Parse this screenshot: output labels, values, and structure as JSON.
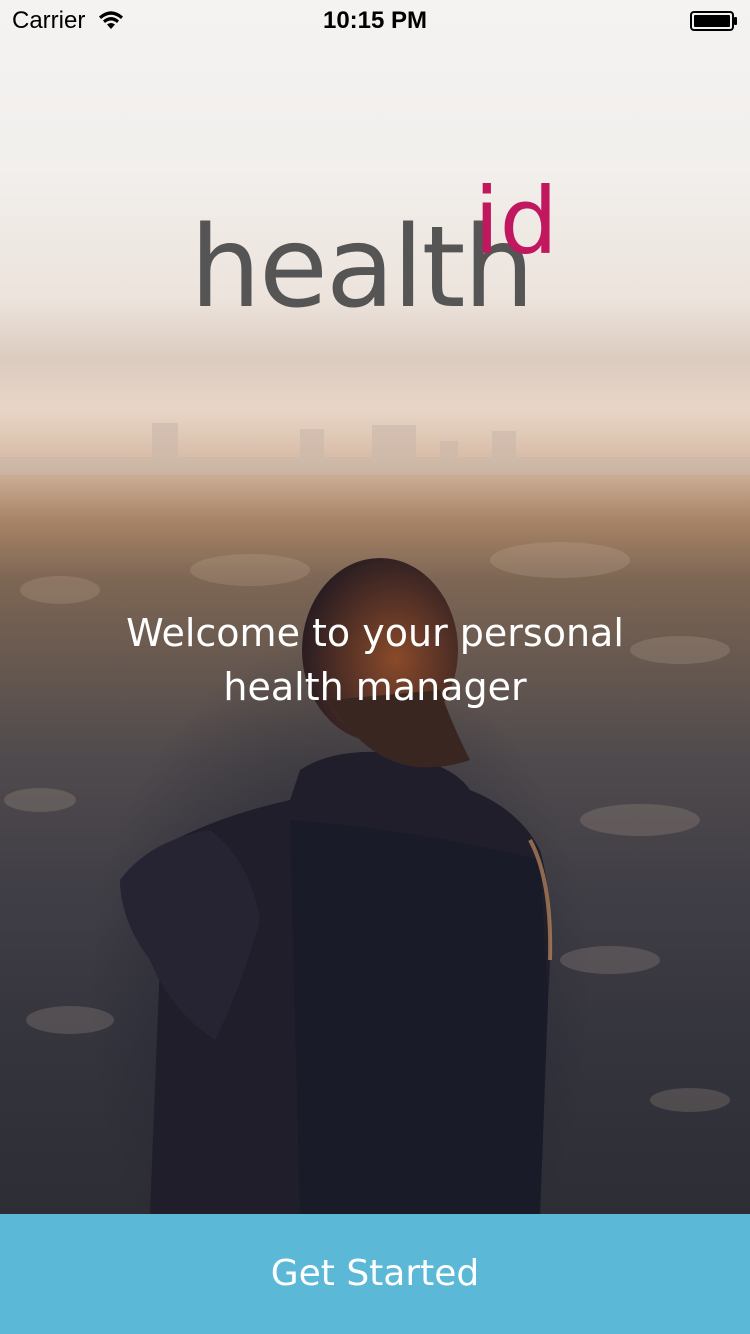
{
  "status_bar": {
    "carrier": "Carrier",
    "time": "10:15 PM",
    "wifi_icon": "wifi-icon",
    "battery_icon": "battery-icon"
  },
  "logo": {
    "word": "health",
    "superscript": "id",
    "word_color": "#555555",
    "superscript_color": "#c1175f"
  },
  "welcome": {
    "message": "Welcome to your personal health manager"
  },
  "primary_action": {
    "label": "Get Started",
    "background_color": "#5bb8d6"
  }
}
